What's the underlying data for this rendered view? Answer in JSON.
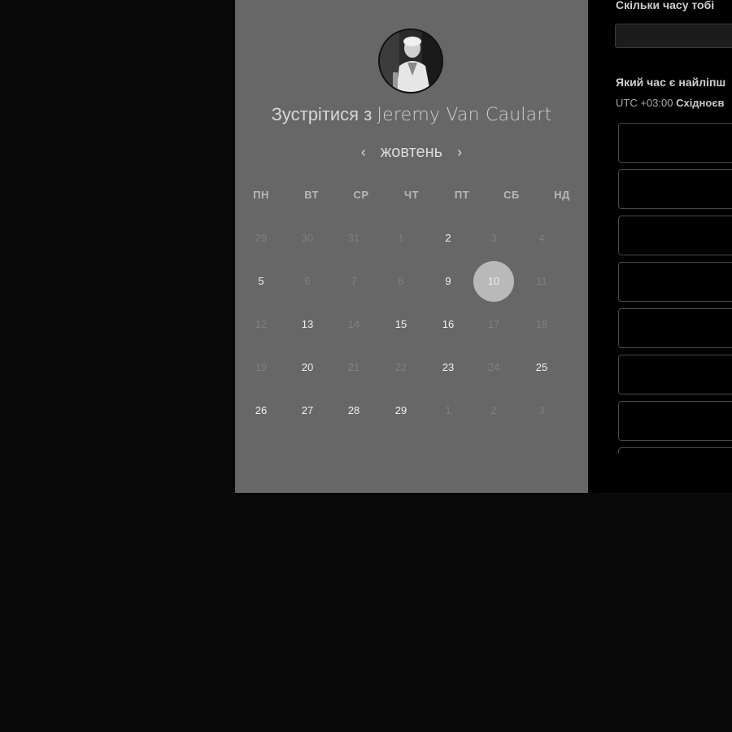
{
  "booking": {
    "title_prefix": "Зустрітися з",
    "host_name": "Jeremy Van Caulart",
    "avatar_alt": "host-avatar"
  },
  "calendar": {
    "month_label": "жовтень",
    "prev_icon": "‹",
    "next_icon": "›",
    "weekdays": [
      "ПН",
      "ВТ",
      "СР",
      "ЧТ",
      "ПТ",
      "СБ",
      "НД"
    ],
    "weeks": [
      [
        {
          "d": "29",
          "s": "muted"
        },
        {
          "d": "30",
          "s": "muted"
        },
        {
          "d": "31",
          "s": "muted"
        },
        {
          "d": "1",
          "s": "muted"
        },
        {
          "d": "2",
          "s": "avail"
        },
        {
          "d": "3",
          "s": "muted"
        },
        {
          "d": "4",
          "s": "muted"
        }
      ],
      [
        {
          "d": "5",
          "s": "avail"
        },
        {
          "d": "6",
          "s": "muted"
        },
        {
          "d": "7",
          "s": "muted"
        },
        {
          "d": "8",
          "s": "muted"
        },
        {
          "d": "9",
          "s": "avail"
        },
        {
          "d": "10",
          "s": "selected"
        },
        {
          "d": "11",
          "s": "muted"
        }
      ],
      [
        {
          "d": "12",
          "s": "muted"
        },
        {
          "d": "13",
          "s": "avail"
        },
        {
          "d": "14",
          "s": "muted"
        },
        {
          "d": "15",
          "s": "avail"
        },
        {
          "d": "16",
          "s": "avail"
        },
        {
          "d": "17",
          "s": "muted"
        },
        {
          "d": "18",
          "s": "muted"
        }
      ],
      [
        {
          "d": "19",
          "s": "muted"
        },
        {
          "d": "20",
          "s": "avail"
        },
        {
          "d": "21",
          "s": "muted"
        },
        {
          "d": "22",
          "s": "muted"
        },
        {
          "d": "23",
          "s": "avail"
        },
        {
          "d": "24",
          "s": "muted"
        },
        {
          "d": "25",
          "s": "avail"
        }
      ],
      [
        {
          "d": "26",
          "s": "avail"
        },
        {
          "d": "27",
          "s": "avail"
        },
        {
          "d": "28",
          "s": "avail"
        },
        {
          "d": "29",
          "s": "avail"
        },
        {
          "d": "1",
          "s": "muted"
        },
        {
          "d": "2",
          "s": "muted"
        },
        {
          "d": "3",
          "s": "muted"
        }
      ]
    ]
  },
  "form": {
    "duration_question": "Скільки часу тобі",
    "duration_value": "",
    "time_question": "Який час є найліпш",
    "tz_offset": "UTC +03:00",
    "tz_name": "Східноєв",
    "slot_labels": [
      "",
      "",
      "",
      "",
      "",
      "",
      "",
      ""
    ]
  },
  "colors": {
    "backdrop": "#0a0a0a",
    "calendar_panel": "#676767",
    "form_panel": "#000000",
    "selected_day": "#b9b9b9"
  }
}
